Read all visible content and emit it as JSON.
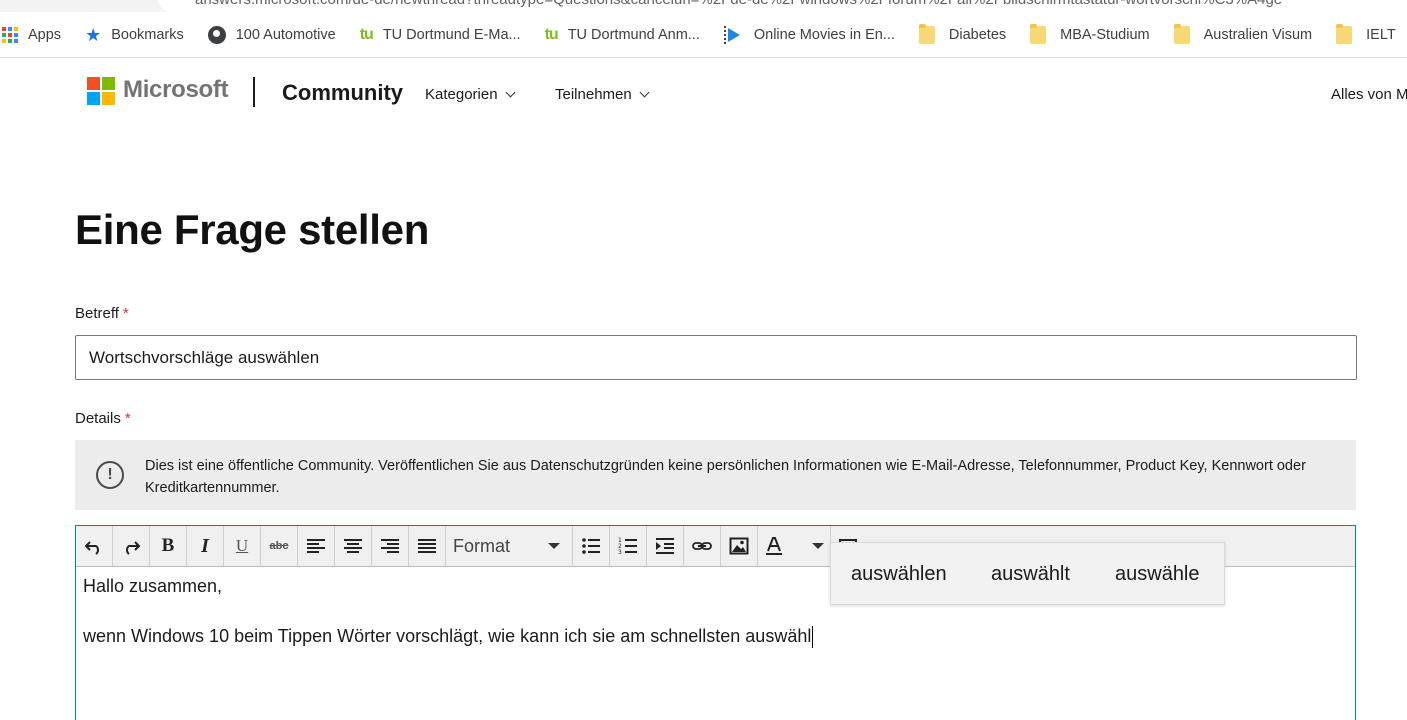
{
  "browser": {
    "url": "answers.microsoft.com/de-de/newthread?threadtype=Questions&cancelurl=%2Fde-de%2Fwindows%2Fforum%2Fall%2Fbildschirmtastatur-wortvorschl%C3%A4ge"
  },
  "bookmarks": [
    {
      "label": "Apps",
      "icon": "apps-grid-icon"
    },
    {
      "label": "Bookmarks",
      "icon": "star-icon"
    },
    {
      "label": "100 Automotive",
      "icon": "globe-icon"
    },
    {
      "label": "TU Dortmund E-Ma...",
      "icon": "tu-logo-icon"
    },
    {
      "label": "TU Dortmund Anm...",
      "icon": "tu-logo-icon"
    },
    {
      "label": "Online Movies in En...",
      "icon": "play-icon"
    },
    {
      "label": "Diabetes",
      "icon": "folder-icon"
    },
    {
      "label": "MBA-Studium",
      "icon": "folder-icon"
    },
    {
      "label": "Australien Visum",
      "icon": "folder-icon"
    },
    {
      "label": "IELT",
      "icon": "folder-icon"
    }
  ],
  "header": {
    "brand": "Microsoft",
    "section": "Community",
    "nav": [
      "Kategorien",
      "Teilnehmen"
    ],
    "search_scope": "Alles von M"
  },
  "page": {
    "title": "Eine Frage stellen",
    "subject_label": "Betreff",
    "subject_value": "Wortschvorschläge auswählen",
    "details_label": "Details",
    "required_mark": "*",
    "notice": "Dies ist eine öffentliche Community. Veröffentlichen Sie aus Datenschutzgründen keine persönlichen Informationen wie E-Mail-Adresse, Telefonnummer, Product Key, Kennwort oder Kreditkartennummer."
  },
  "editor": {
    "format_label": "Format",
    "line1": "Hallo zusammen,",
    "line2": "wenn Windows 10 beim Tippen Wörter vorschlägt, wie kann ich sie am schnellsten auswähl"
  },
  "suggestions": [
    "auswählen",
    "auswählt",
    "auswähle"
  ],
  "colors": {
    "accent_blue": "#0078d4",
    "required_red": "#d13438",
    "ms_red": "#f25022",
    "ms_green": "#7fba00",
    "ms_blue": "#00a4ef",
    "ms_yellow": "#ffb900",
    "notice_bg": "#ececec"
  }
}
